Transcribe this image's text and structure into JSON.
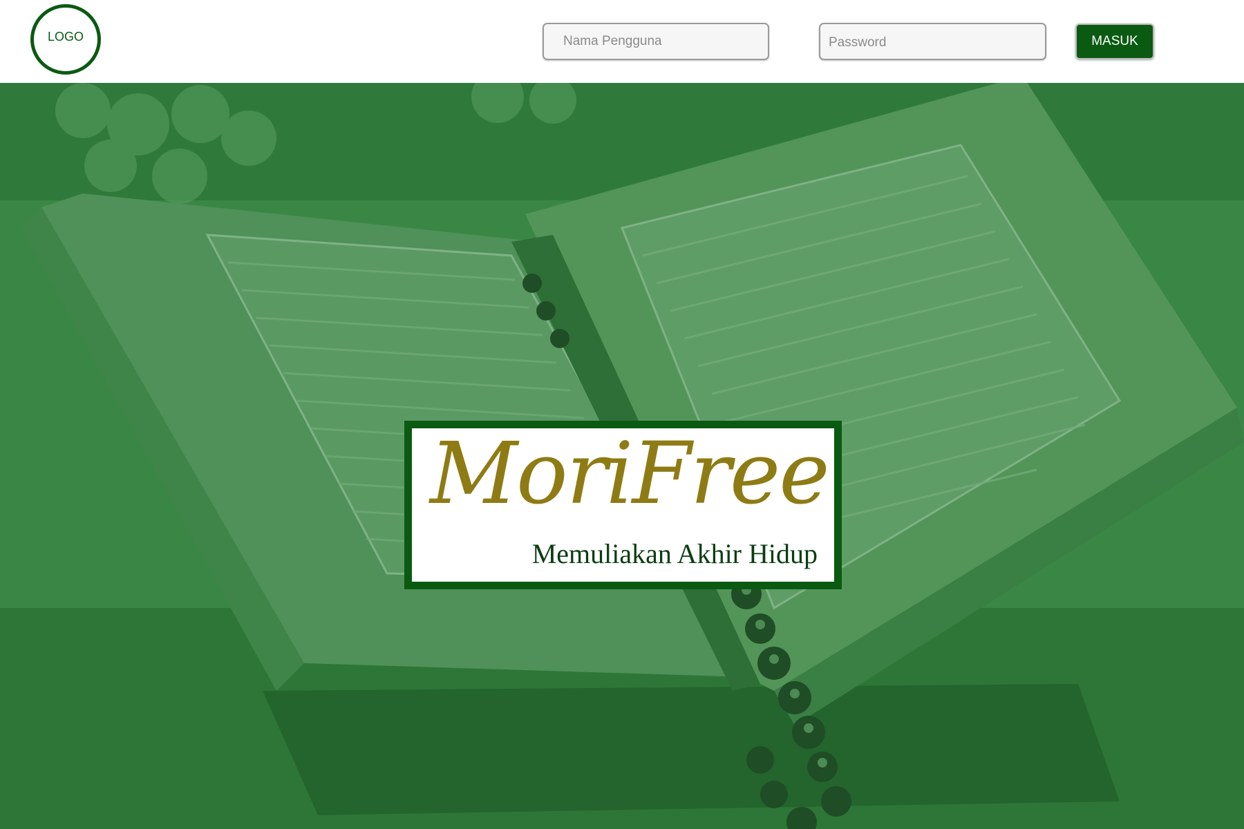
{
  "header": {
    "logo_text": "LOGO",
    "username_placeholder": "Nama Pengguna",
    "password_placeholder": "Password",
    "login_label": "MASUK"
  },
  "hero": {
    "background_image": "quran-book-icon",
    "brand_name": "MoriFree",
    "tagline": "Memuliakan Akhir Hidup"
  },
  "colors": {
    "primary_green": "#0b5a12",
    "overlay_green": "#2f7d3a",
    "brand_gold": "#8e7b14"
  }
}
